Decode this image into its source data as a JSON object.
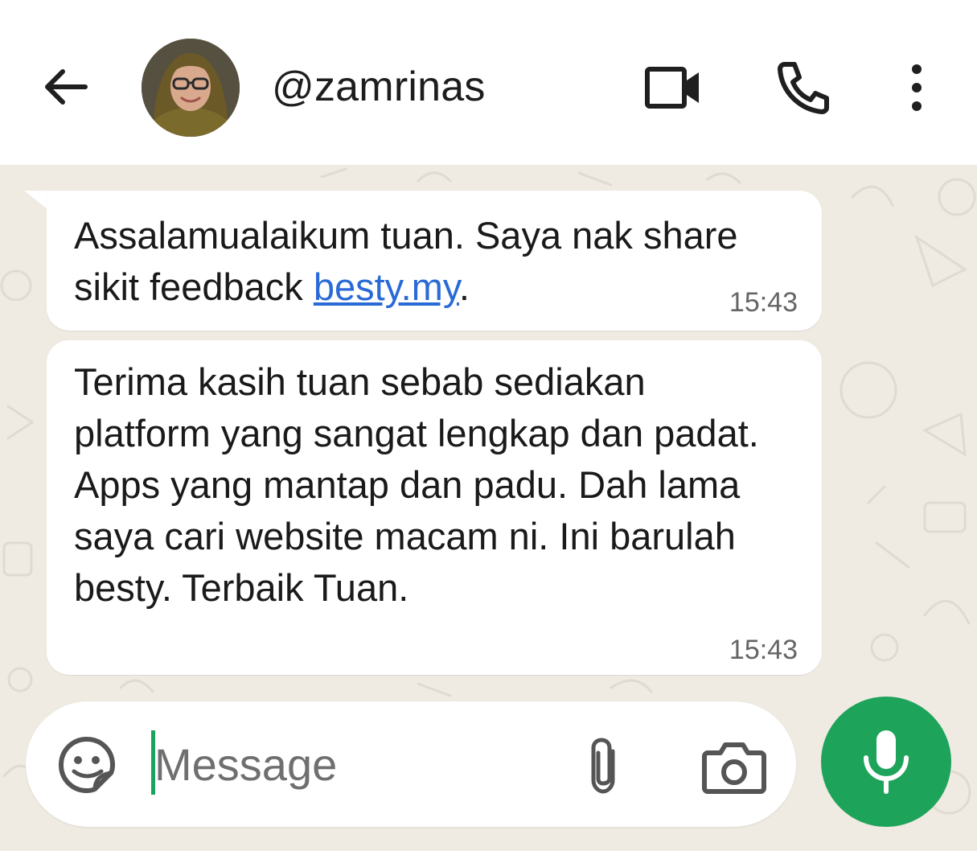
{
  "header": {
    "contact_name": "@zamrinas",
    "icons": [
      "back-arrow-icon",
      "video-call-icon",
      "voice-call-icon",
      "more-options-icon"
    ]
  },
  "messages": [
    {
      "text_before_link": "Assalamualaikum tuan. Saya nak share sikit feedback ",
      "link": "besty.my",
      "text_after_link": ".",
      "time": "15:43"
    },
    {
      "text": "Terima kasih tuan sebab sediakan platform yang sangat lengkap dan padat. Apps yang mantap dan padu. Dah lama saya cari website macam ni. Ini barulah besty. Terbaik Tuan.",
      "time": "15:43"
    }
  ],
  "composer": {
    "placeholder": "Message",
    "icons": [
      "emoji-sticker-icon",
      "attachment-icon",
      "camera-icon",
      "microphone-icon"
    ]
  },
  "colors": {
    "chat_background": "#efeae2",
    "link": "#2a6ad6",
    "mic_button": "#1ea35a",
    "cursor": "#1aa260"
  }
}
